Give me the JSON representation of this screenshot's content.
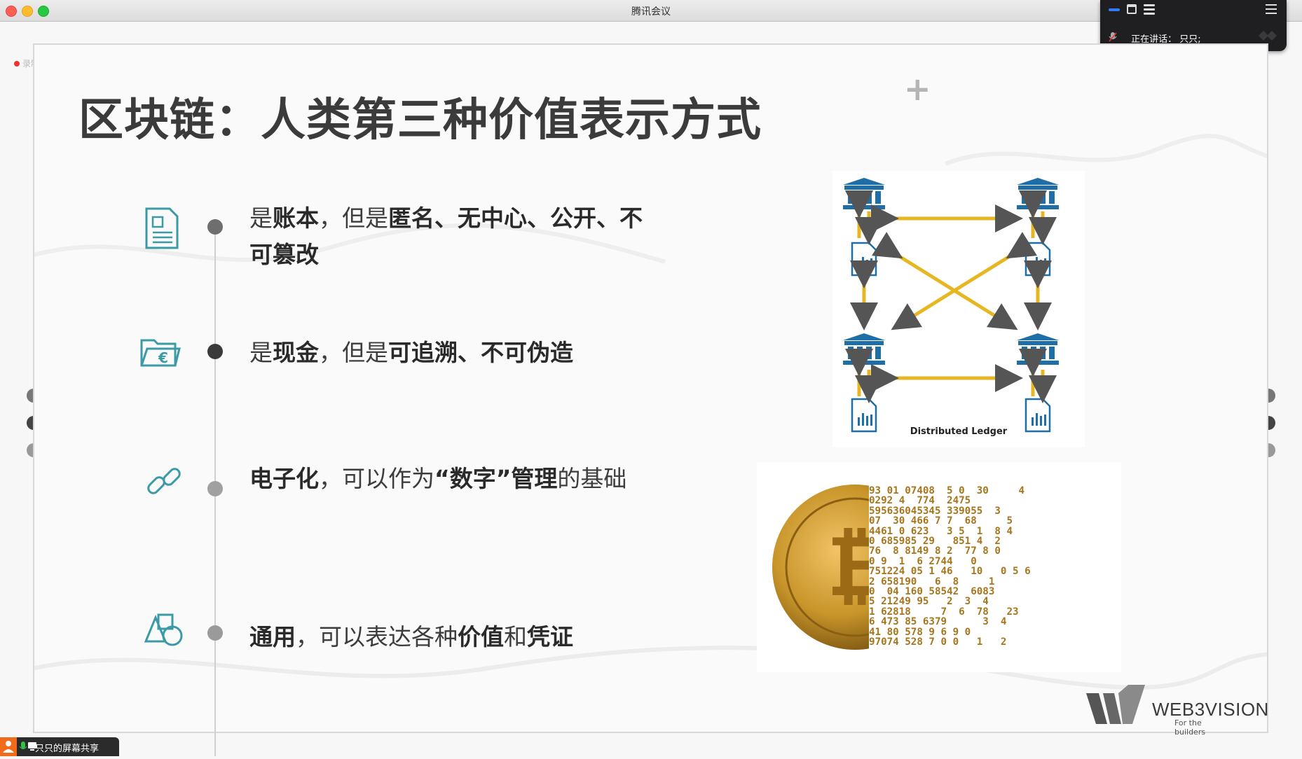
{
  "window": {
    "title": "腾讯会议"
  },
  "speaker_panel": {
    "speaking_label": "正在讲话：",
    "speaker_name": "只只;"
  },
  "recording": {
    "label": "录制中"
  },
  "slide": {
    "title": "区块链：人类第三种价值表示方式",
    "bullets": [
      {
        "icon": "document-icon",
        "parts": [
          {
            "t": "是",
            "b": false
          },
          {
            "t": "账本",
            "b": true
          },
          {
            "t": "，但是",
            "b": false
          },
          {
            "t": "匿名、无中心、公开、不可篡改",
            "b": true
          }
        ]
      },
      {
        "icon": "euro-folder-icon",
        "parts": [
          {
            "t": "是",
            "b": false
          },
          {
            "t": "现金",
            "b": true
          },
          {
            "t": "，但是",
            "b": false
          },
          {
            "t": "可追溯、不可伪造",
            "b": true
          }
        ]
      },
      {
        "icon": "link-icon",
        "parts": [
          {
            "t": "电子化",
            "b": true
          },
          {
            "t": "，可以作为",
            "b": false
          },
          {
            "t": "“数字”",
            "b": true
          },
          {
            "t": "管理",
            "b": true
          },
          {
            "t": "的基础",
            "b": false
          }
        ]
      },
      {
        "icon": "shapes-icon",
        "parts": [
          {
            "t": "通用",
            "b": true
          },
          {
            "t": "，可以表达各种",
            "b": false
          },
          {
            "t": "价值",
            "b": true
          },
          {
            "t": "和",
            "b": false
          },
          {
            "t": "凭证",
            "b": true
          }
        ]
      }
    ],
    "ledger_caption": "Distributed Ledger",
    "bitcoin_digits": [
      "93 01 07408  5 0  30     4",
      "0292 4  774  2475",
      "595636045345 339055  3",
      "07  30 466 7 7  68     5",
      "4461 0 623   3 5  1  8 4",
      "0 685985 29   851 4  2",
      "76  8 8149 8 2  77 8 0",
      "0 9  1  6 2744   0",
      "751224 05 1 46   10   0 5 6",
      "2 658190   6  8     1",
      "0  04 160 58542  6083",
      "5 21249 95   2  3  4",
      "1 62818     7  6  78   23",
      "6 473 85 6379      3  4",
      "41 80 578 9 6 9 0",
      "97074 528 7 0 0   1   2"
    ],
    "logo": {
      "brand": "WEB3VISION",
      "tagline": "For the builders"
    }
  },
  "bottom_bar": {
    "label": "只只的屏幕共享"
  },
  "colors": {
    "bank_blue": "#1e6fa8",
    "arrow_gold": "#e6b722",
    "teal_icon": "#3a9aa5",
    "coin_gold": "#c8952a"
  }
}
